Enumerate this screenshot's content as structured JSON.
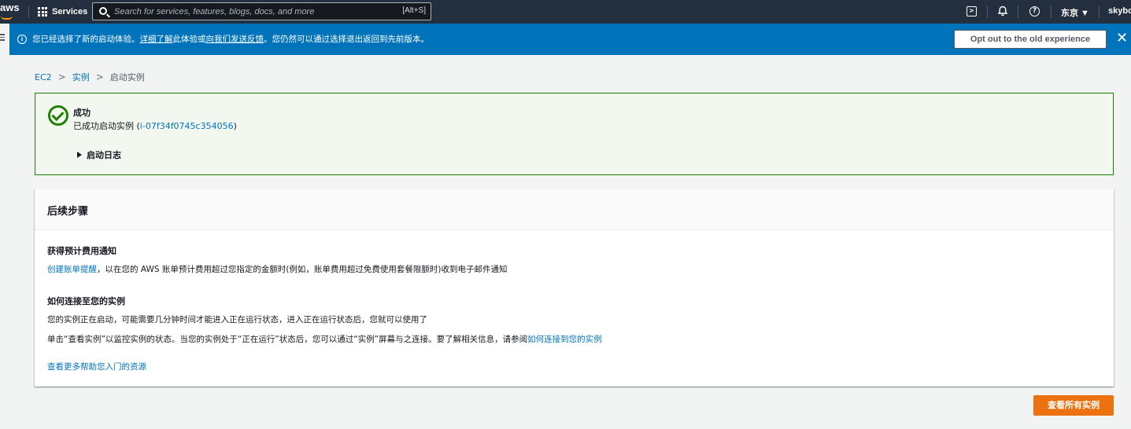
{
  "nav": {
    "logo": "aws",
    "services_label": "Services",
    "search_placeholder": "Search for services, features, blogs, docs, and more",
    "search_shortcut": "[Alt+S]",
    "region": "东京 ▼",
    "user": "skyboy"
  },
  "flash": {
    "text_before": "您已经选择了新的启动体验。",
    "link1": "详细了解",
    "text_mid1": "此体验或",
    "link2": "向我们发送反馈",
    "text_after": "。您仍然可以通过选择退出返回到先前版本。",
    "optout_label": "Opt out to the old experience"
  },
  "breadcrumb": {
    "items": [
      "EC2",
      "实例",
      "启动实例"
    ]
  },
  "success": {
    "title": "成功",
    "message_prefix": "已成功启动实例 (",
    "instance_id": "i-07f34f0745c354056",
    "message_suffix": ")",
    "log_toggle": "启动日志"
  },
  "next_steps": {
    "title": "后续步骤",
    "billing_heading": "获得预计费用通知",
    "billing_link": "创建账单提醒",
    "billing_text": "，以在您的 AWS 账单预计费用超过您指定的金额时(例如，账单费用超过免费使用套餐限额时)收到电子邮件通知",
    "connect_heading": "如何连接至您的实例",
    "connect_text1": "您的实例正在启动，可能需要几分钟时间才能进入正在运行状态，进入正在运行状态后，您就可以使用了",
    "connect_text2": "单击“查看实例”以监控实例的状态。当您的实例处于“正在运行”状态后，您可以通过“实例”屏幕与之连接。要了解相关信息，请参阅",
    "connect_link": "如何连接到您的实例",
    "resources_link": "查看更多帮助您入门的资源"
  },
  "actions": {
    "view_all_instances": "查看所有实例"
  },
  "colors": {
    "nav_bg": "#232f3e",
    "flash_bg": "#0073bb",
    "success_border": "#1d8102",
    "primary_button": "#ec7211",
    "link": "#0073bb"
  }
}
